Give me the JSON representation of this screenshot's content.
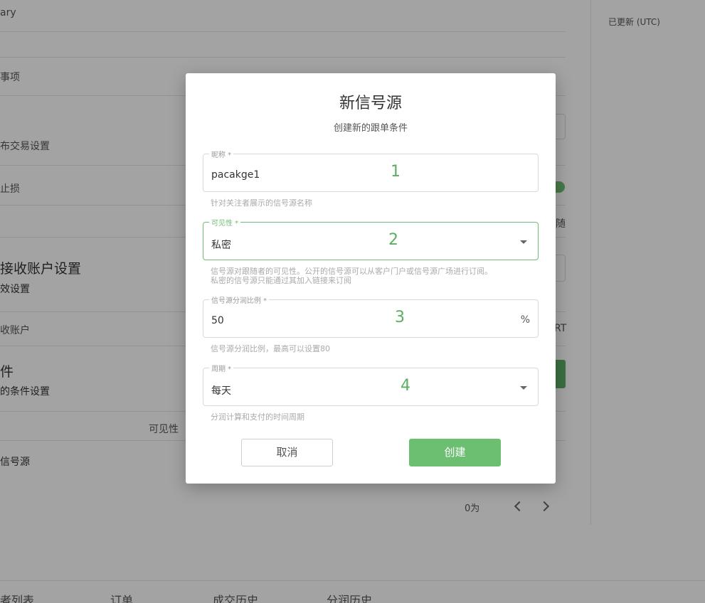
{
  "background": {
    "texts": {
      "t1": "ary",
      "t2": "事项",
      "t3": "布交易设置",
      "t4": "止损",
      "t5": "随",
      "t6": "接收账户设置",
      "t7": "效设置",
      "t8": "收账户",
      "t9": "RT",
      "t10": "件",
      "t11": "的条件设置",
      "t12": "可见性",
      "t13": "信号源",
      "t14": "0为",
      "updated_label": "已更新 (UTC)"
    },
    "tabs": [
      "者列表",
      "订单",
      "成交历史",
      "分润历史"
    ]
  },
  "dialog": {
    "title": "新信号源",
    "subtitle": "创建新的跟单条件",
    "name_field": {
      "label": "昵称 *",
      "value": "pacakge1",
      "marker": "1",
      "hint": "针对关注者展示的信号源名称"
    },
    "visibility_field": {
      "label": "可见性 *",
      "value": "私密",
      "marker": "2",
      "hint_line1": "信号源对跟随者的可见性。公开的信号源可以从客户门户或信号源广场进行订阅。",
      "hint_line2": "私密的信号源只能通过其加入链接来订阅"
    },
    "ratio_field": {
      "label": "信号源分润比例 *",
      "value": "50",
      "suffix": "%",
      "marker": "3",
      "hint": "信号源分润比例，最高可以设置80"
    },
    "period_field": {
      "label": "周期 *",
      "value": "每天",
      "marker": "4",
      "hint": "分润计算和支付的时间周期"
    },
    "cancel_label": "取消",
    "create_label": "创建"
  },
  "colors": {
    "accent": "#6cbf71",
    "marker": "#5aaf5f"
  }
}
